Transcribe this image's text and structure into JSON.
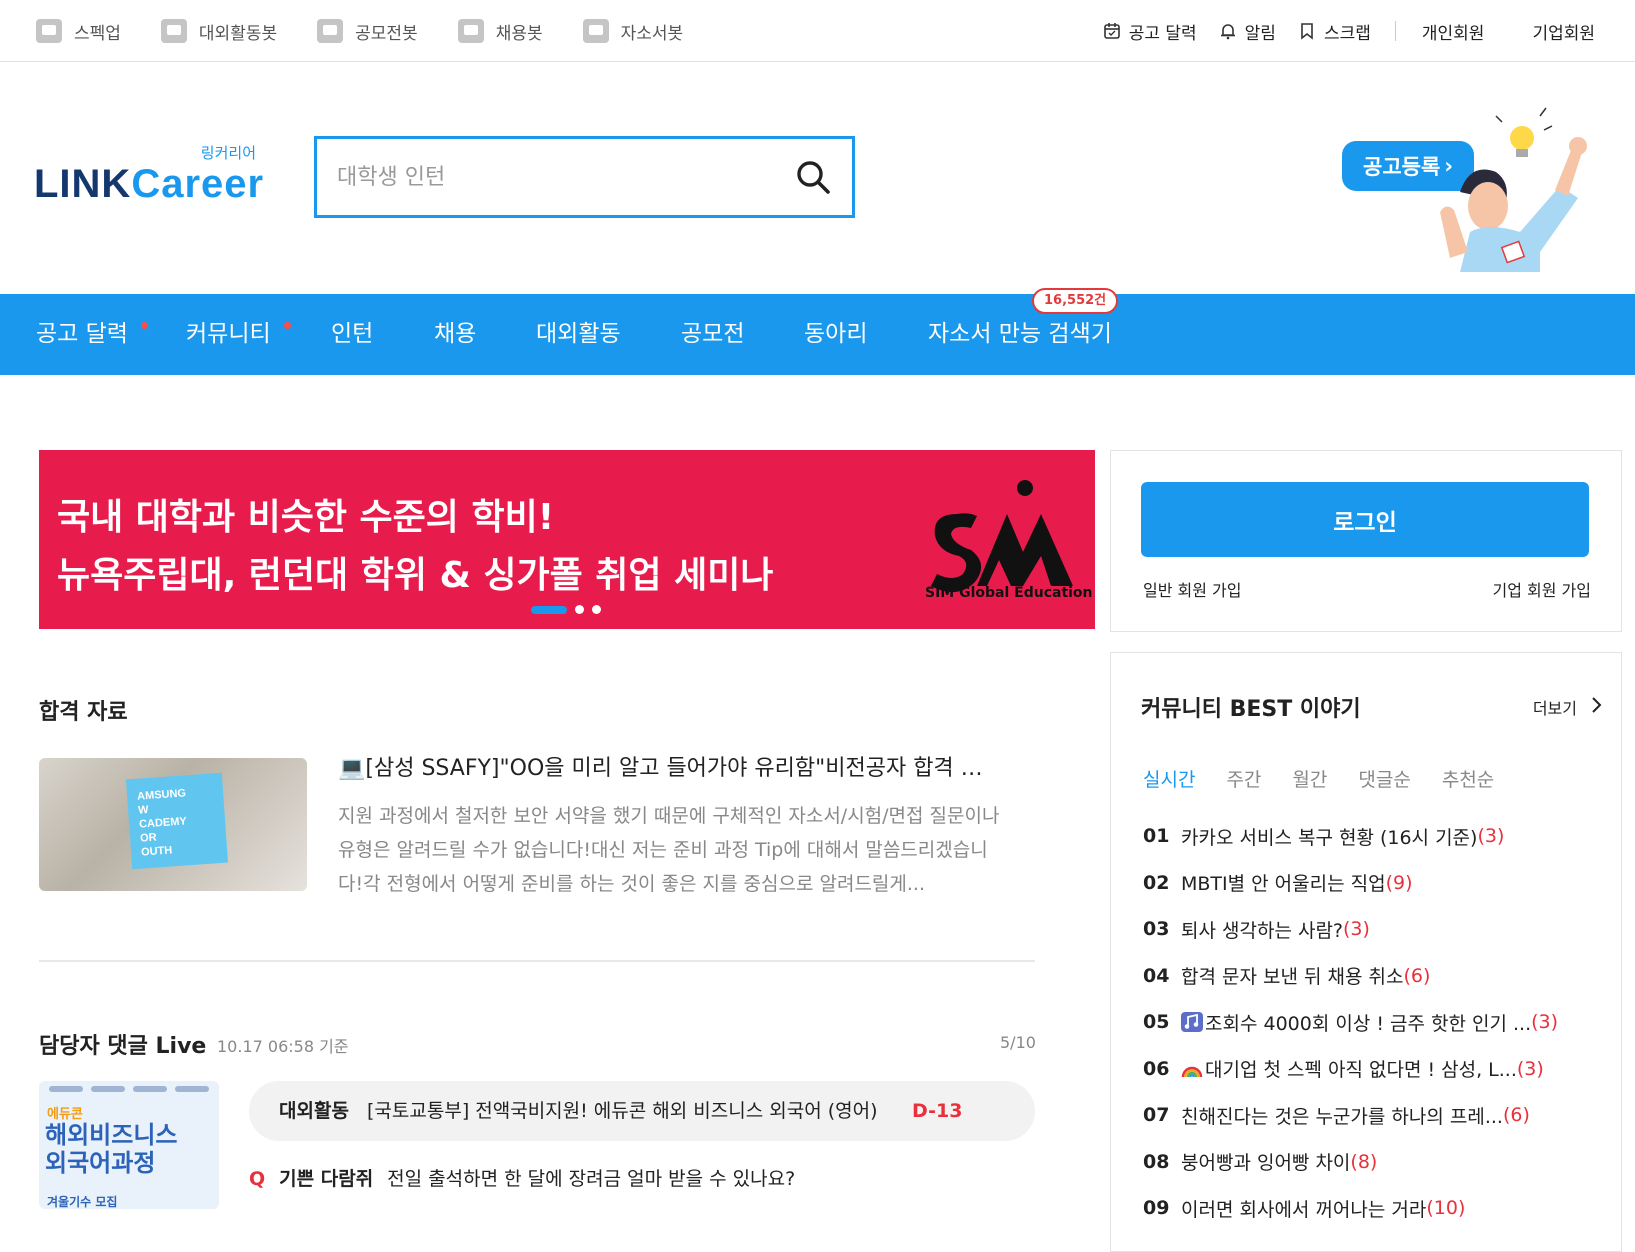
{
  "topbar": {
    "bots": [
      {
        "label": "스펙업",
        "icon": "cup-icon"
      },
      {
        "label": "대외활동봇",
        "icon": "chat-icon"
      },
      {
        "label": "공모전봇",
        "icon": "chat-icon"
      },
      {
        "label": "채용봇",
        "icon": "chat-icon"
      },
      {
        "label": "자소서봇",
        "icon": "chat-icon"
      }
    ],
    "calendar": "공고 달력",
    "alarm": "알림",
    "scrap": "스크랩",
    "personal": "개인회원",
    "corporate": "기업회원"
  },
  "logo": {
    "sub": "링커리어",
    "main_a": "LINK",
    "main_b": "areer",
    "main_c": "C"
  },
  "search": {
    "placeholder": "대학생 인턴"
  },
  "post_button": "공고등록",
  "nav": {
    "items": [
      "공고 달력",
      "커뮤니티",
      "인턴",
      "채용",
      "대외활동",
      "공모전",
      "동아리",
      "자소서 만능 검색기"
    ],
    "badge": "16,552건"
  },
  "banner": {
    "line1": "국내 대학과 비슷한 수준의 학비!",
    "line2": "뉴욕주립대, 런던대 학위 & 싱가폴 취업 세미나",
    "brand": "SIM Global Education"
  },
  "login": {
    "button": "로그인",
    "join_general": "일반 회원 가입",
    "join_corp": "기업 회원 가입"
  },
  "pass_section": {
    "title": "합격 자료",
    "thumb_lines": [
      "AMSUNG",
      "W",
      "CADEMY",
      "OR",
      "OUTH"
    ],
    "article_title": "💻[삼성 SSAFY]\"OO을 미리 알고 들어가야 유리함\"비전공자 합격 후기",
    "article_body": "지원 과정에서 철저한 보안 서약을 했기 때문에 구체적인 자소서/시험/면접 질문이나 유형은 알려드릴 수가 없습니다!대신 저는 준비 과정 Tip에 대해서 말씀드리겠습니다!각 전형에서 어떻게 준비를 하는 것이 좋은 지를 중심으로 알려드릴게..."
  },
  "live": {
    "title": "담당자 댓글 Live",
    "time": "10.17 06:58 기준",
    "page": "5/10",
    "thumb": {
      "t1": "에듀콘",
      "t2a": "해외비즈니스",
      "t2b": "외국어과정",
      "t3": "겨울기수 모집"
    },
    "row": {
      "category": "대외활동",
      "title": "[국토교통부] 전액국비지원! 에듀콘 해외 비즈니스 외국어 (영어)",
      "dday": "D-13"
    },
    "qa": {
      "mark": "Q",
      "category": "기쁜 다람쥐",
      "text": "전일 출석하면 한 달에 장려금 얼마 받을 수 있나요?"
    }
  },
  "community": {
    "title": "커뮤니티 BEST 이야기",
    "more": "더보기",
    "tabs": [
      "실시간",
      "주간",
      "월간",
      "댓글순",
      "추천순"
    ],
    "items": [
      {
        "num": "01",
        "text": "카카오 서비스 복구 현황 (16시 기준)",
        "count": "(3)"
      },
      {
        "num": "02",
        "text": "MBTI별 안 어울리는 직업",
        "count": "(9)"
      },
      {
        "num": "03",
        "text": "퇴사 생각하는 사람?",
        "count": "(3)"
      },
      {
        "num": "04",
        "text": "합격 문자 보낸 뒤 채용 취소",
        "count": "(6)"
      },
      {
        "num": "05",
        "text": "조회수 4000회 이상 ! 금주 핫한 인기 ...",
        "count": "(3)",
        "emoji": "music-note-icon"
      },
      {
        "num": "06",
        "text": "대기업 첫 스펙 아직 없다면 ! 삼성, L...",
        "count": "(3)",
        "emoji": "rainbow-icon"
      },
      {
        "num": "07",
        "text": "친해진다는 것은 누군가를 하나의 프레...",
        "count": "(6)"
      },
      {
        "num": "08",
        "text": "붕어빵과 잉어빵 차이",
        "count": "(8)"
      },
      {
        "num": "09",
        "text": "이러면 회사에서 꺼어나는 거라",
        "count": "(10)"
      }
    ]
  },
  "colors": {
    "primary": "#1a98ee",
    "banner": "#e81c4c",
    "alert": "#e8313b",
    "logo_dark": "#14376d"
  }
}
